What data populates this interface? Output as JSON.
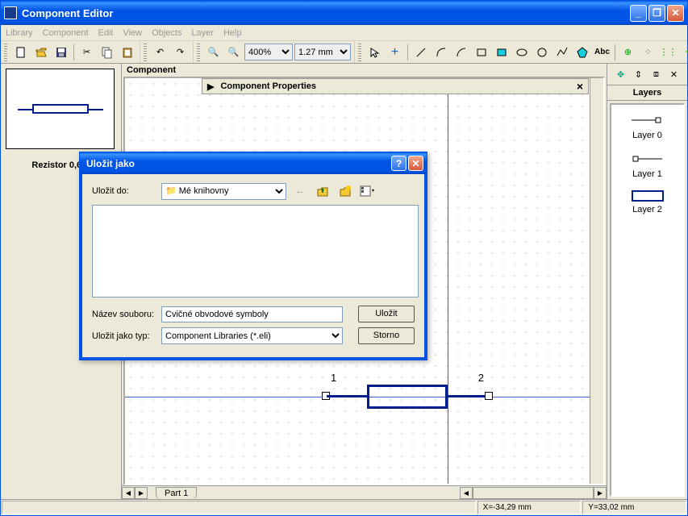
{
  "window": {
    "title": "Component Editor"
  },
  "menu": {
    "library": "Library",
    "component": "Component",
    "edit": "Edit",
    "view": "View",
    "objects": "Objects",
    "layer": "Layer",
    "help": "Help"
  },
  "toolbar": {
    "zoom": "400%",
    "grid": "1.27 mm"
  },
  "left": {
    "compName": "Rezistor 0,6W"
  },
  "center": {
    "label": "Component",
    "propTitle": "Component Properties",
    "pin1": "1",
    "pin2": "2",
    "tab": "Part 1"
  },
  "right": {
    "title": "Layers",
    "l0": "Layer 0",
    "l1": "Layer 1",
    "l2": "Layer 2"
  },
  "status": {
    "x": "X=-34,29 mm",
    "y": "Y=33,02 mm"
  },
  "dialog": {
    "title": "Uložit jako",
    "saveInLabel": "Uložit do:",
    "saveInValue": "Mé knihovny",
    "fileNameLabel": "Název souboru:",
    "fileNameValue": "Cvičné obvodové symboly",
    "typeLabel": "Uložit jako typ:",
    "typeValue": "Component Libraries (*.eli)",
    "saveBtn": "Uložit",
    "cancelBtn": "Storno"
  }
}
